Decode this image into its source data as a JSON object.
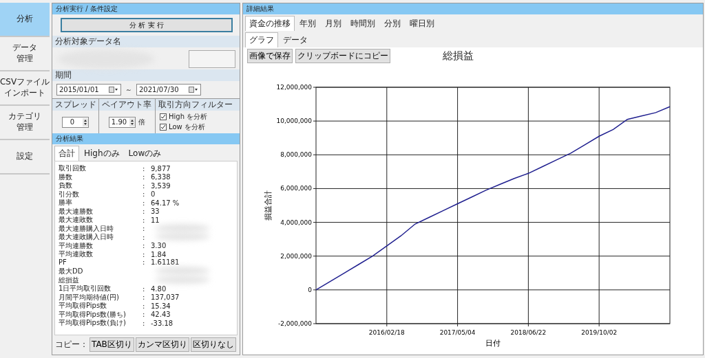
{
  "sidebar": {
    "items": [
      {
        "lines": [
          "分析"
        ],
        "selected": true
      },
      {
        "lines": [
          "データ",
          "管理"
        ],
        "selected": false
      },
      {
        "lines": [
          "CSVファイル",
          "インポート"
        ],
        "selected": false
      },
      {
        "lines": [
          "カテゴリ",
          "管理"
        ],
        "selected": false
      },
      {
        "lines": [
          "設定"
        ],
        "selected": false
      }
    ]
  },
  "conditions": {
    "title": "分析実行 / 条件設定",
    "run_button": "分 析 実 行",
    "data_name_label": "分析対象データ名",
    "period_label": "期間",
    "date_from": "2015/01/01",
    "range_sep": "～",
    "date_to": "2021/07/30",
    "spread_label": "スプレッド",
    "spread_value": "0",
    "payout_label": "ペイアウト率",
    "payout_value": "1.90",
    "payout_unit": "倍",
    "filter_label": "取引方向フィルター",
    "filters": [
      {
        "label": "High を分析",
        "checked": true
      },
      {
        "label": "Low を分析",
        "checked": true
      }
    ]
  },
  "results": {
    "title": "分析結果",
    "tabs": [
      {
        "label": "合計",
        "selected": true
      },
      {
        "label": "Highのみ",
        "selected": false
      },
      {
        "label": "Lowのみ",
        "selected": false
      }
    ],
    "rows": [
      {
        "label": "取引回数",
        "sep": ":",
        "kind": "text",
        "value": "9,877"
      },
      {
        "label": "勝数",
        "sep": ":",
        "kind": "text",
        "value": "6,338"
      },
      {
        "label": "負数",
        "sep": ":",
        "kind": "text",
        "value": "3,539"
      },
      {
        "label": "引分数",
        "sep": ":",
        "kind": "text",
        "value": "0"
      },
      {
        "label": "勝率",
        "sep": ":",
        "kind": "text",
        "value": "64.17 %"
      },
      {
        "label": "最大連勝数",
        "sep": ":",
        "kind": "text",
        "value": "33"
      },
      {
        "label": "最大連敗数",
        "sep": ":",
        "kind": "text",
        "value": "11"
      },
      {
        "label": "最大連勝購入日時",
        "sep": ":",
        "kind": "blurred"
      },
      {
        "label": "最大連敗購入日時",
        "sep": ":",
        "kind": "blurred"
      },
      {
        "label": "平均連勝数",
        "sep": ":",
        "kind": "text",
        "value": "3.30"
      },
      {
        "label": "平均連敗数",
        "sep": ":",
        "kind": "text",
        "value": "1.84"
      },
      {
        "label": "PF",
        "sep": ":",
        "kind": "text",
        "value": "1.61181"
      },
      {
        "label": "最大DD",
        "kind": "blurred"
      },
      {
        "label": "総損益",
        "kind": "blurred"
      },
      {
        "label": "1日平均取引回数",
        "sep": ":",
        "kind": "text",
        "value": "4.80"
      },
      {
        "label": "月間平均期待値(円)",
        "sep": ":",
        "kind": "text",
        "value": "137,037"
      },
      {
        "label": "平均取得Pips数",
        "sep": ":",
        "kind": "text",
        "value": "15.34"
      },
      {
        "label": "平均取得Pips数(勝ち)",
        "sep": ":",
        "kind": "text",
        "value": "42.43"
      },
      {
        "label": "平均取得Pips数(負け)",
        "sep": ":",
        "kind": "text",
        "value": "-33.18"
      }
    ],
    "copy_label": "コピー：",
    "copy_buttons": [
      "TAB区切り",
      "カンマ区切り",
      "区切りなし"
    ]
  },
  "details": {
    "title": "詳細結果",
    "tabs": [
      {
        "label": "資金の推移",
        "selected": true
      },
      {
        "label": "年別",
        "selected": false
      },
      {
        "label": "月別",
        "selected": false
      },
      {
        "label": "時間別",
        "selected": false
      },
      {
        "label": "分別",
        "selected": false
      },
      {
        "label": "曜日別",
        "selected": false
      }
    ],
    "subtabs": [
      {
        "label": "グラフ",
        "selected": true
      },
      {
        "label": "データ",
        "selected": false
      }
    ],
    "buttons": [
      "画像で保存",
      "クリップボードにコピー"
    ],
    "chart_data": {
      "type": "line",
      "title": "総損益",
      "xlabel": "日付",
      "ylabel": "損益合計",
      "categories": [
        null,
        null,
        null,
        null,
        null,
        "2016/02/18",
        null,
        null,
        null,
        null,
        "2017/05/04",
        null,
        null,
        null,
        null,
        "2018/06/22",
        null,
        null,
        null,
        null,
        "2019/10/02",
        null,
        null,
        null,
        null,
        null
      ],
      "series": [
        {
          "color": "#1f1f8f",
          "values": [
            0,
            500000,
            1000000,
            1500000,
            2000000,
            2600000,
            3200000,
            3900000,
            4300000,
            4700000,
            5100000,
            5500000,
            5900000,
            6250000,
            6600000,
            6900000,
            7300000,
            7700000,
            8100000,
            8600000,
            9100000,
            9500000,
            10100000,
            10300000,
            10500000,
            10850000
          ]
        }
      ],
      "ylim": [
        -2000000,
        12000000
      ],
      "grid": true,
      "yticks": [
        {
          "value": -2000000,
          "label": "-2,000,000"
        },
        {
          "value": 0,
          "label": "0"
        },
        {
          "value": 2000000,
          "label": "2,000,000"
        },
        {
          "value": 4000000,
          "label": "4,000,000"
        },
        {
          "value": 6000000,
          "label": "6,000,000"
        },
        {
          "value": 8000000,
          "label": "8,000,000"
        },
        {
          "value": 10000000,
          "label": "10,000,000"
        },
        {
          "value": 12000000,
          "label": "12,000,000"
        }
      ]
    }
  }
}
